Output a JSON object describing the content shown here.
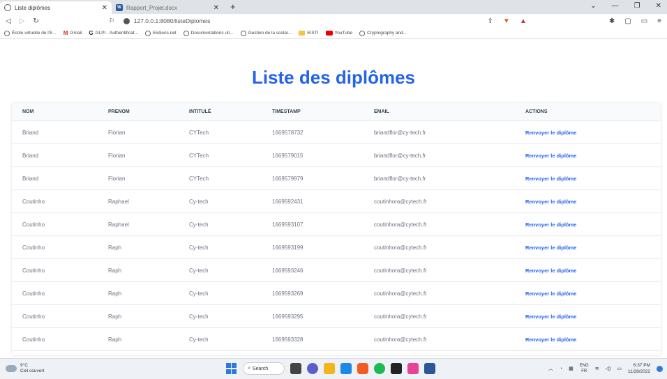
{
  "browser": {
    "tabs": [
      {
        "title": "Liste diplômes",
        "active": true
      },
      {
        "title": "Rapport_Projet.docx",
        "active": false
      }
    ],
    "new_tab": "+",
    "url": "127.0.0.1:8080/listeDiplomes",
    "bookmarks": [
      {
        "label": "École virtuelle de l'E...",
        "icon": "globe-icon"
      },
      {
        "label": "Gmail",
        "icon": "gmail-icon"
      },
      {
        "label": "GLPI - Authentificat...",
        "icon": "g-icon"
      },
      {
        "label": "Eistiens.net",
        "icon": "globe-icon"
      },
      {
        "label": "Documentations uti...",
        "icon": "globe-icon"
      },
      {
        "label": "Gestion de la scolar...",
        "icon": "globe-icon"
      },
      {
        "label": "EISTI",
        "icon": "folder-icon"
      },
      {
        "label": "YouTube",
        "icon": "youtube-icon"
      },
      {
        "label": "Cryptography and...",
        "icon": "globe-icon"
      }
    ]
  },
  "page": {
    "title": "Liste des diplômes",
    "columns": [
      "NOM",
      "PRENOM",
      "INTITULÉ",
      "TIMESTAMP",
      "EMAIL",
      "ACTIONS"
    ],
    "rows": [
      {
        "nom": "Briand",
        "prenom": "Florian",
        "intitule": "CYTech",
        "timestamp": "1669578732",
        "email": "briandflor@cy-tech.fr",
        "action": "Renvoyer le diplôme"
      },
      {
        "nom": "Briand",
        "prenom": "Florian",
        "intitule": "CYTech",
        "timestamp": "1669579015",
        "email": "briandflor@cy-tech.fr",
        "action": "Renvoyer le diplôme"
      },
      {
        "nom": "Briand",
        "prenom": "Florian",
        "intitule": "CYTech",
        "timestamp": "1669579979",
        "email": "briandflor@cy-tech.fr",
        "action": "Renvoyer le diplôme"
      },
      {
        "nom": "Coutinho",
        "prenom": "Raphael",
        "intitule": "Cy-tech",
        "timestamp": "1669592431",
        "email": "coutinhora@cytech.fr",
        "action": "Renvoyer le diplôme"
      },
      {
        "nom": "Coutinho",
        "prenom": "Raphael",
        "intitule": "Cy-tech",
        "timestamp": "1669593107",
        "email": "coutinhora@cytech.fr",
        "action": "Renvoyer le diplôme"
      },
      {
        "nom": "Coutinho",
        "prenom": "Raph",
        "intitule": "Cy-tech",
        "timestamp": "1669593199",
        "email": "coutinhora@cytech.fr",
        "action": "Renvoyer le diplôme"
      },
      {
        "nom": "Coutinho",
        "prenom": "Raph",
        "intitule": "Cy-tech",
        "timestamp": "1669593246",
        "email": "coutinhora@cytech.fr",
        "action": "Renvoyer le diplôme"
      },
      {
        "nom": "Coutinho",
        "prenom": "Raph",
        "intitule": "Cy-tech",
        "timestamp": "1669593269",
        "email": "coutinhora@cytech.fr",
        "action": "Renvoyer le diplôme"
      },
      {
        "nom": "Coutinho",
        "prenom": "Raph",
        "intitule": "Cy-tech",
        "timestamp": "1669593295",
        "email": "coutinhora@cytech.fr",
        "action": "Renvoyer le diplôme"
      },
      {
        "nom": "Coutinho",
        "prenom": "Raph",
        "intitule": "Cy-tech",
        "timestamp": "1669593328",
        "email": "coutinhora@cytech.fr",
        "action": "Renvoyer le diplôme"
      }
    ]
  },
  "taskbar": {
    "weather_temp": "9°C",
    "weather_desc": "Ciel couvert",
    "search_label": "Search",
    "lang_top": "ENG",
    "lang_bottom": "FR",
    "time": "6:37 PM",
    "date": "11/28/2022"
  },
  "colors": {
    "accent": "#2563eb",
    "header_bg": "#f9fafb",
    "tabstrip_bg": "#dfe3e8"
  }
}
